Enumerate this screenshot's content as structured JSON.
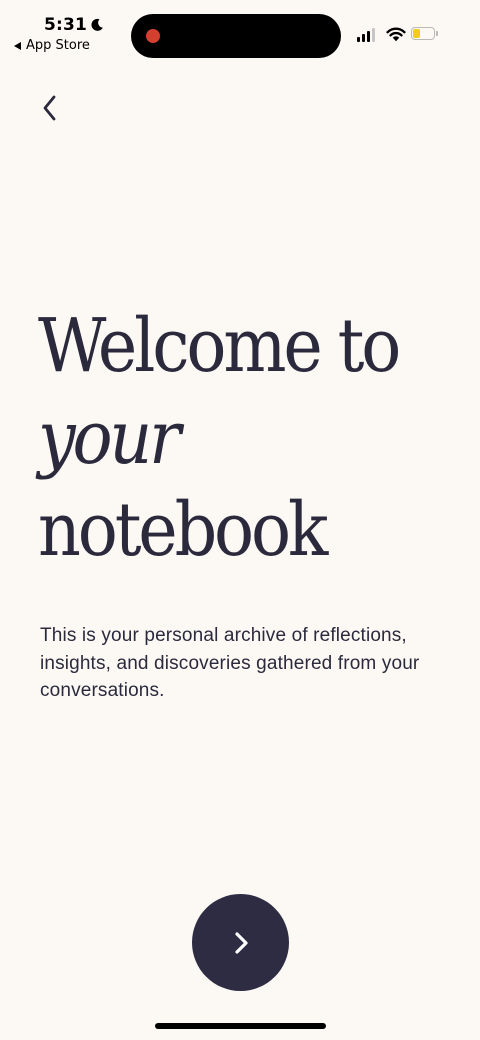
{
  "status_bar": {
    "time": "5:31",
    "back_app_label": "App Store",
    "battery_level": 0.35,
    "battery_color": "#f4cc1c",
    "recording_color": "#d3402f"
  },
  "navigation": {
    "back_icon": "chevron-left-icon"
  },
  "headline": {
    "line1": "Welcome to",
    "line2": "your",
    "line3": "notebook"
  },
  "description": "This is your personal archive of reflections, insights, and discoveries gathered from your conversations.",
  "next_button": {
    "icon": "chevron-right-icon",
    "color": "#2d2c43"
  }
}
